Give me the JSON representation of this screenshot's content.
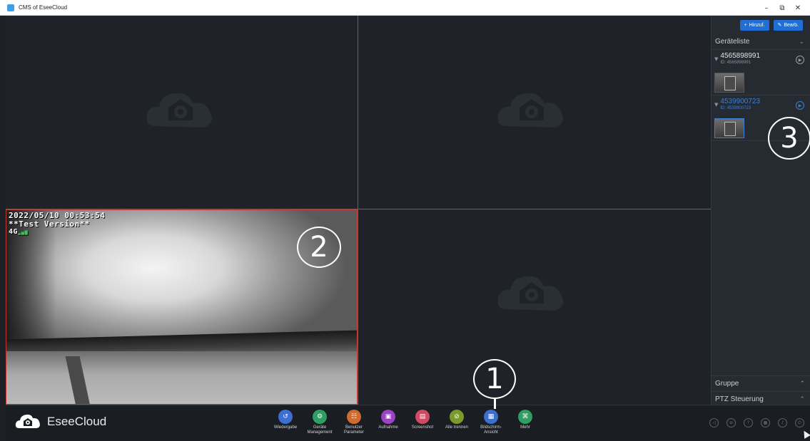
{
  "window": {
    "title": "CMS of EseeCloud",
    "minimize_glyph": "–",
    "maximize_glyph": "⧉",
    "close_glyph": "✕"
  },
  "video": {
    "timestamp": "2022/05/10 00:53:54",
    "version_text": "**Test Version**",
    "signal_text": "4G",
    "signal_bars": "▂▄▆"
  },
  "callouts": {
    "one": "1",
    "two": "2",
    "three": "3"
  },
  "sidebar": {
    "add_button": "Hinzuf.",
    "add_icon": "+",
    "edit_button": "Bearb.",
    "edit_icon": "✎",
    "device_list_label": "Geräteliste",
    "chevron_down": "⌄",
    "devices": [
      {
        "name": "4565898991",
        "id": "ID: 4565898991"
      },
      {
        "name": "4539900723",
        "id": "ID: 4539900723"
      }
    ],
    "group_label": "Gruppe",
    "ptz_label": "PTZ Steuerung",
    "chevron_up": "⌃"
  },
  "toolbar": {
    "brand": "EseeCloud",
    "tools": [
      {
        "label": "Wiedergabe",
        "icon": "↺",
        "color": "#3d6fd0"
      },
      {
        "label": "Geräte\nManagement",
        "icon": "⚙",
        "color": "#2f9e62"
      },
      {
        "label": "Benutzer\nParameter",
        "icon": "☷",
        "color": "#d06a2f"
      },
      {
        "label": "Aufnahme",
        "icon": "▣",
        "color": "#9c42c4"
      },
      {
        "label": "Screenshot",
        "icon": "▤",
        "color": "#d04a63"
      },
      {
        "label": "Alle trennen",
        "icon": "⊘",
        "color": "#7a9a2a"
      },
      {
        "label": "Bildschirm-\nAnsicht",
        "icon": "▦",
        "color": "#3d6fd0"
      },
      {
        "label": "Mehr",
        "icon": "⌘",
        "color": "#2f9e62"
      }
    ],
    "status_icons": [
      "◁",
      "⊖",
      "?",
      "▦",
      "♪",
      "⏻"
    ]
  }
}
